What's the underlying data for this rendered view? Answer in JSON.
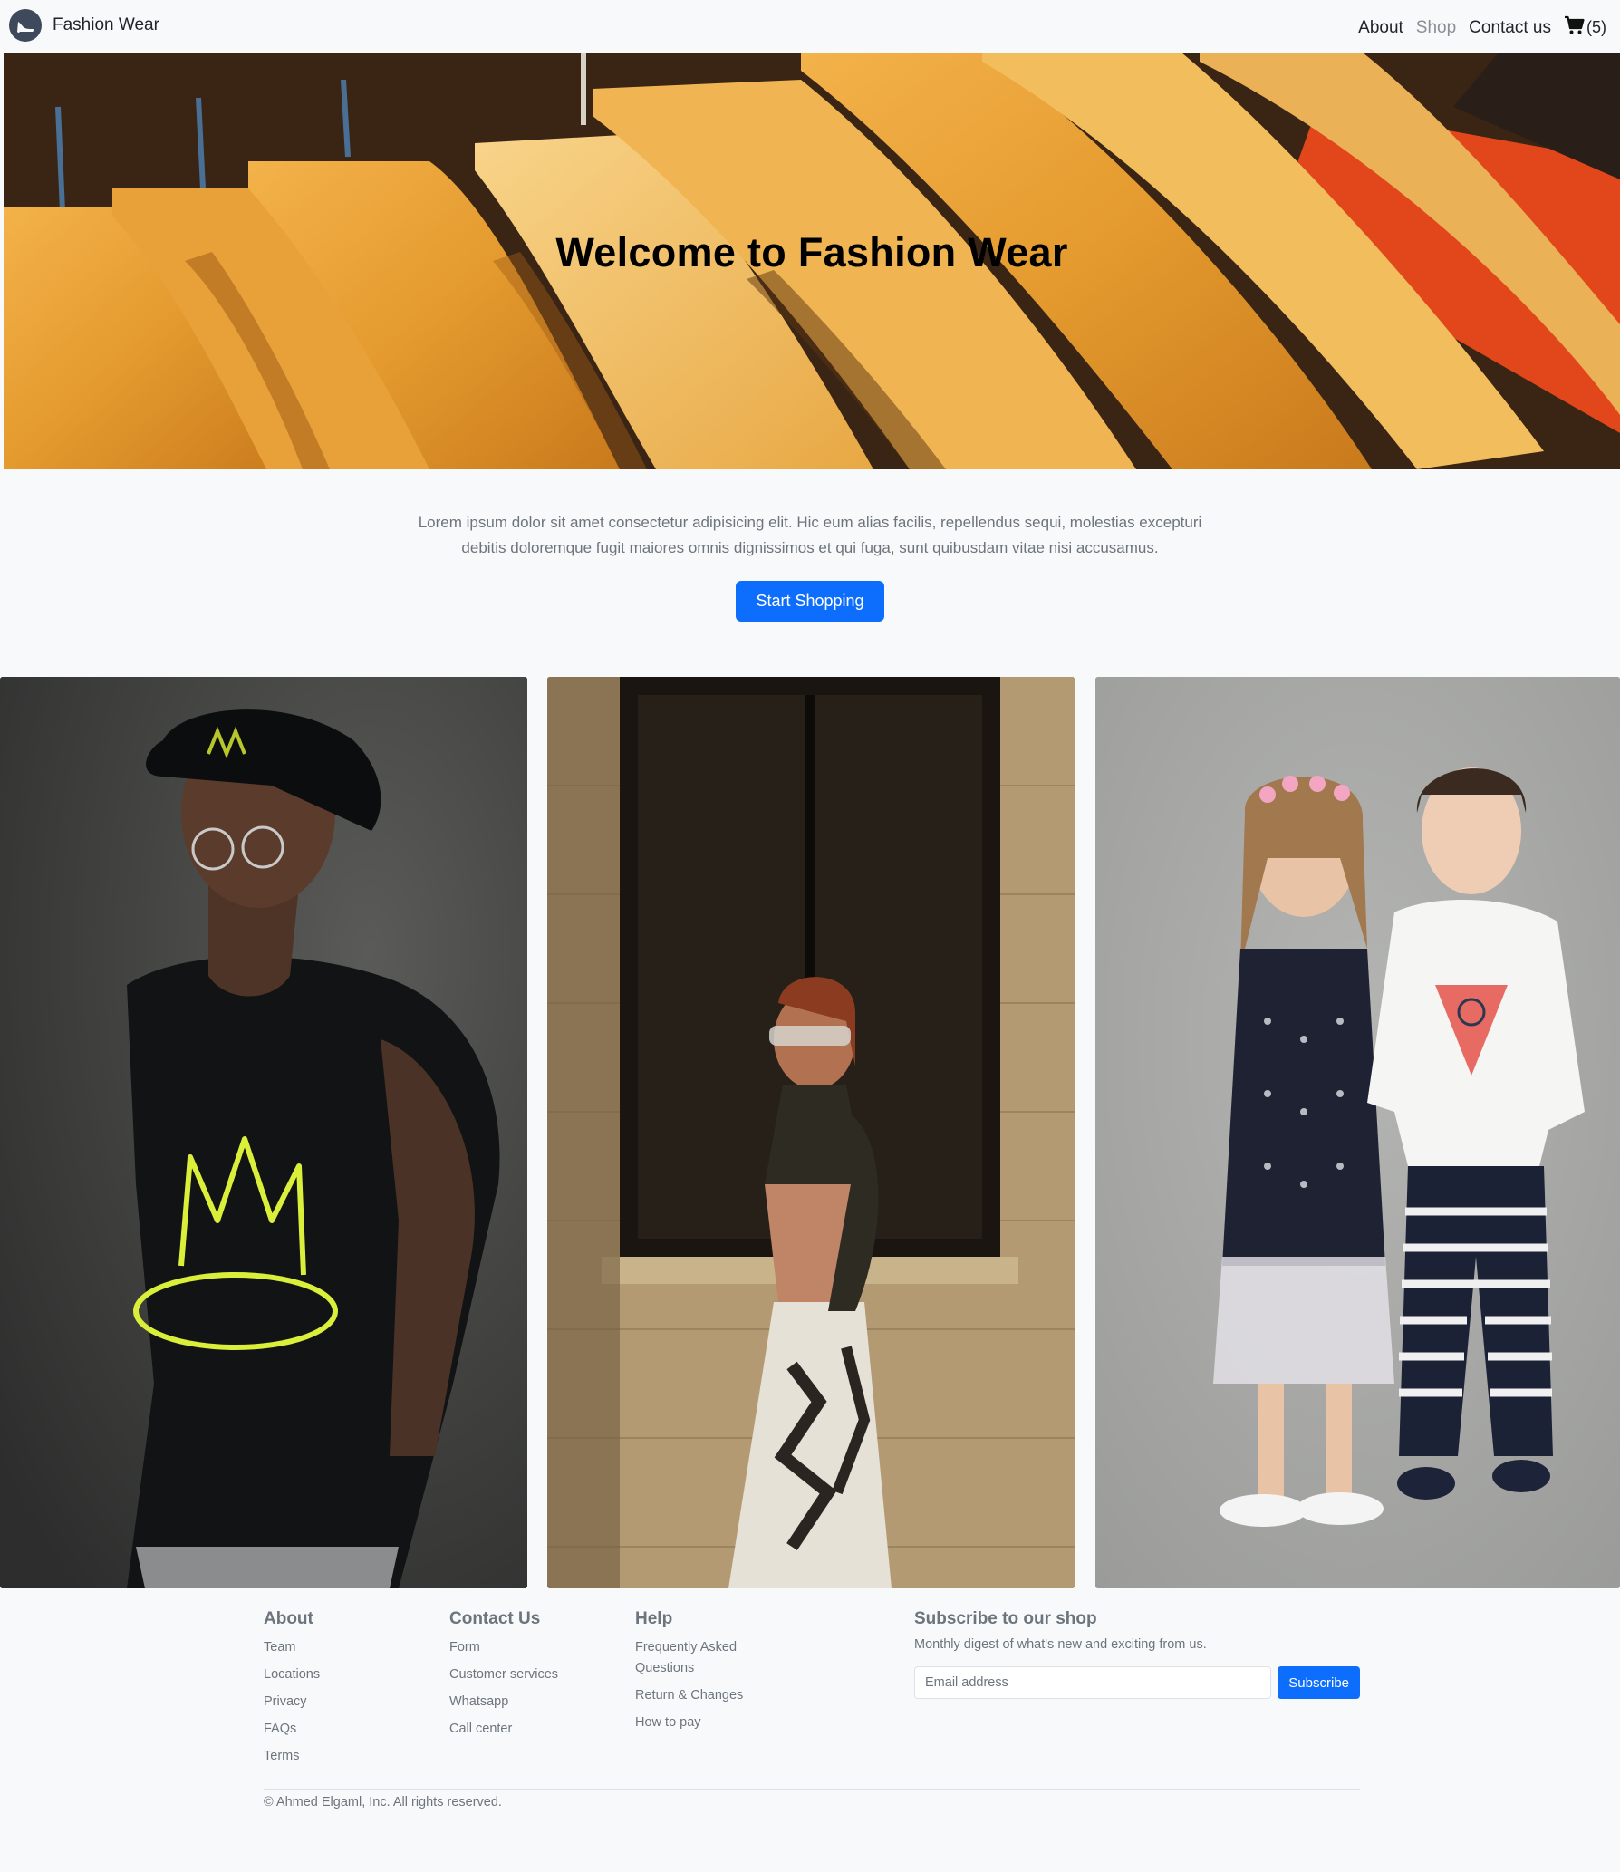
{
  "navbar": {
    "brand_name": "Fashion Wear",
    "links": {
      "about": "About",
      "shop": "Shop",
      "contact": "Contact us"
    },
    "cart_count": "(5)"
  },
  "hero": {
    "title": "Welcome to Fashion Wear"
  },
  "intro": {
    "text": "Lorem ipsum dolor sit amet consectetur adipisicing elit. Hic eum alias facilis, repellendus sequi, molestias excepturi debitis doloremque fugit maiores omnis dignissimos et qui fuga, sunt quibusdam vitae nisi accusamus.",
    "button_label": "Start Shopping"
  },
  "footer": {
    "about": {
      "heading": "About",
      "items": [
        "Team",
        "Locations",
        "Privacy",
        "FAQs",
        "Terms"
      ]
    },
    "contact": {
      "heading": "Contact Us",
      "items": [
        "Form",
        "Customer services",
        "Whatsapp",
        "Call center"
      ]
    },
    "help": {
      "heading": "Help",
      "items": [
        "Frequently Asked Questions",
        "Return & Changes",
        "How to pay"
      ]
    },
    "subscribe": {
      "heading": "Subscribe to our shop",
      "description": "Monthly digest of what's new and exciting from us.",
      "email_placeholder": "Email address",
      "button_label": "Subscribe"
    },
    "copyright": "© Ahmed Elgaml, Inc. All rights reserved."
  },
  "colors": {
    "primary": "#0d6efd",
    "background": "#f8f9fa",
    "muted_text": "#6c757d"
  },
  "icons": {
    "brand": "high-heel-shoe-icon",
    "cart": "shopping-cart-icon"
  }
}
